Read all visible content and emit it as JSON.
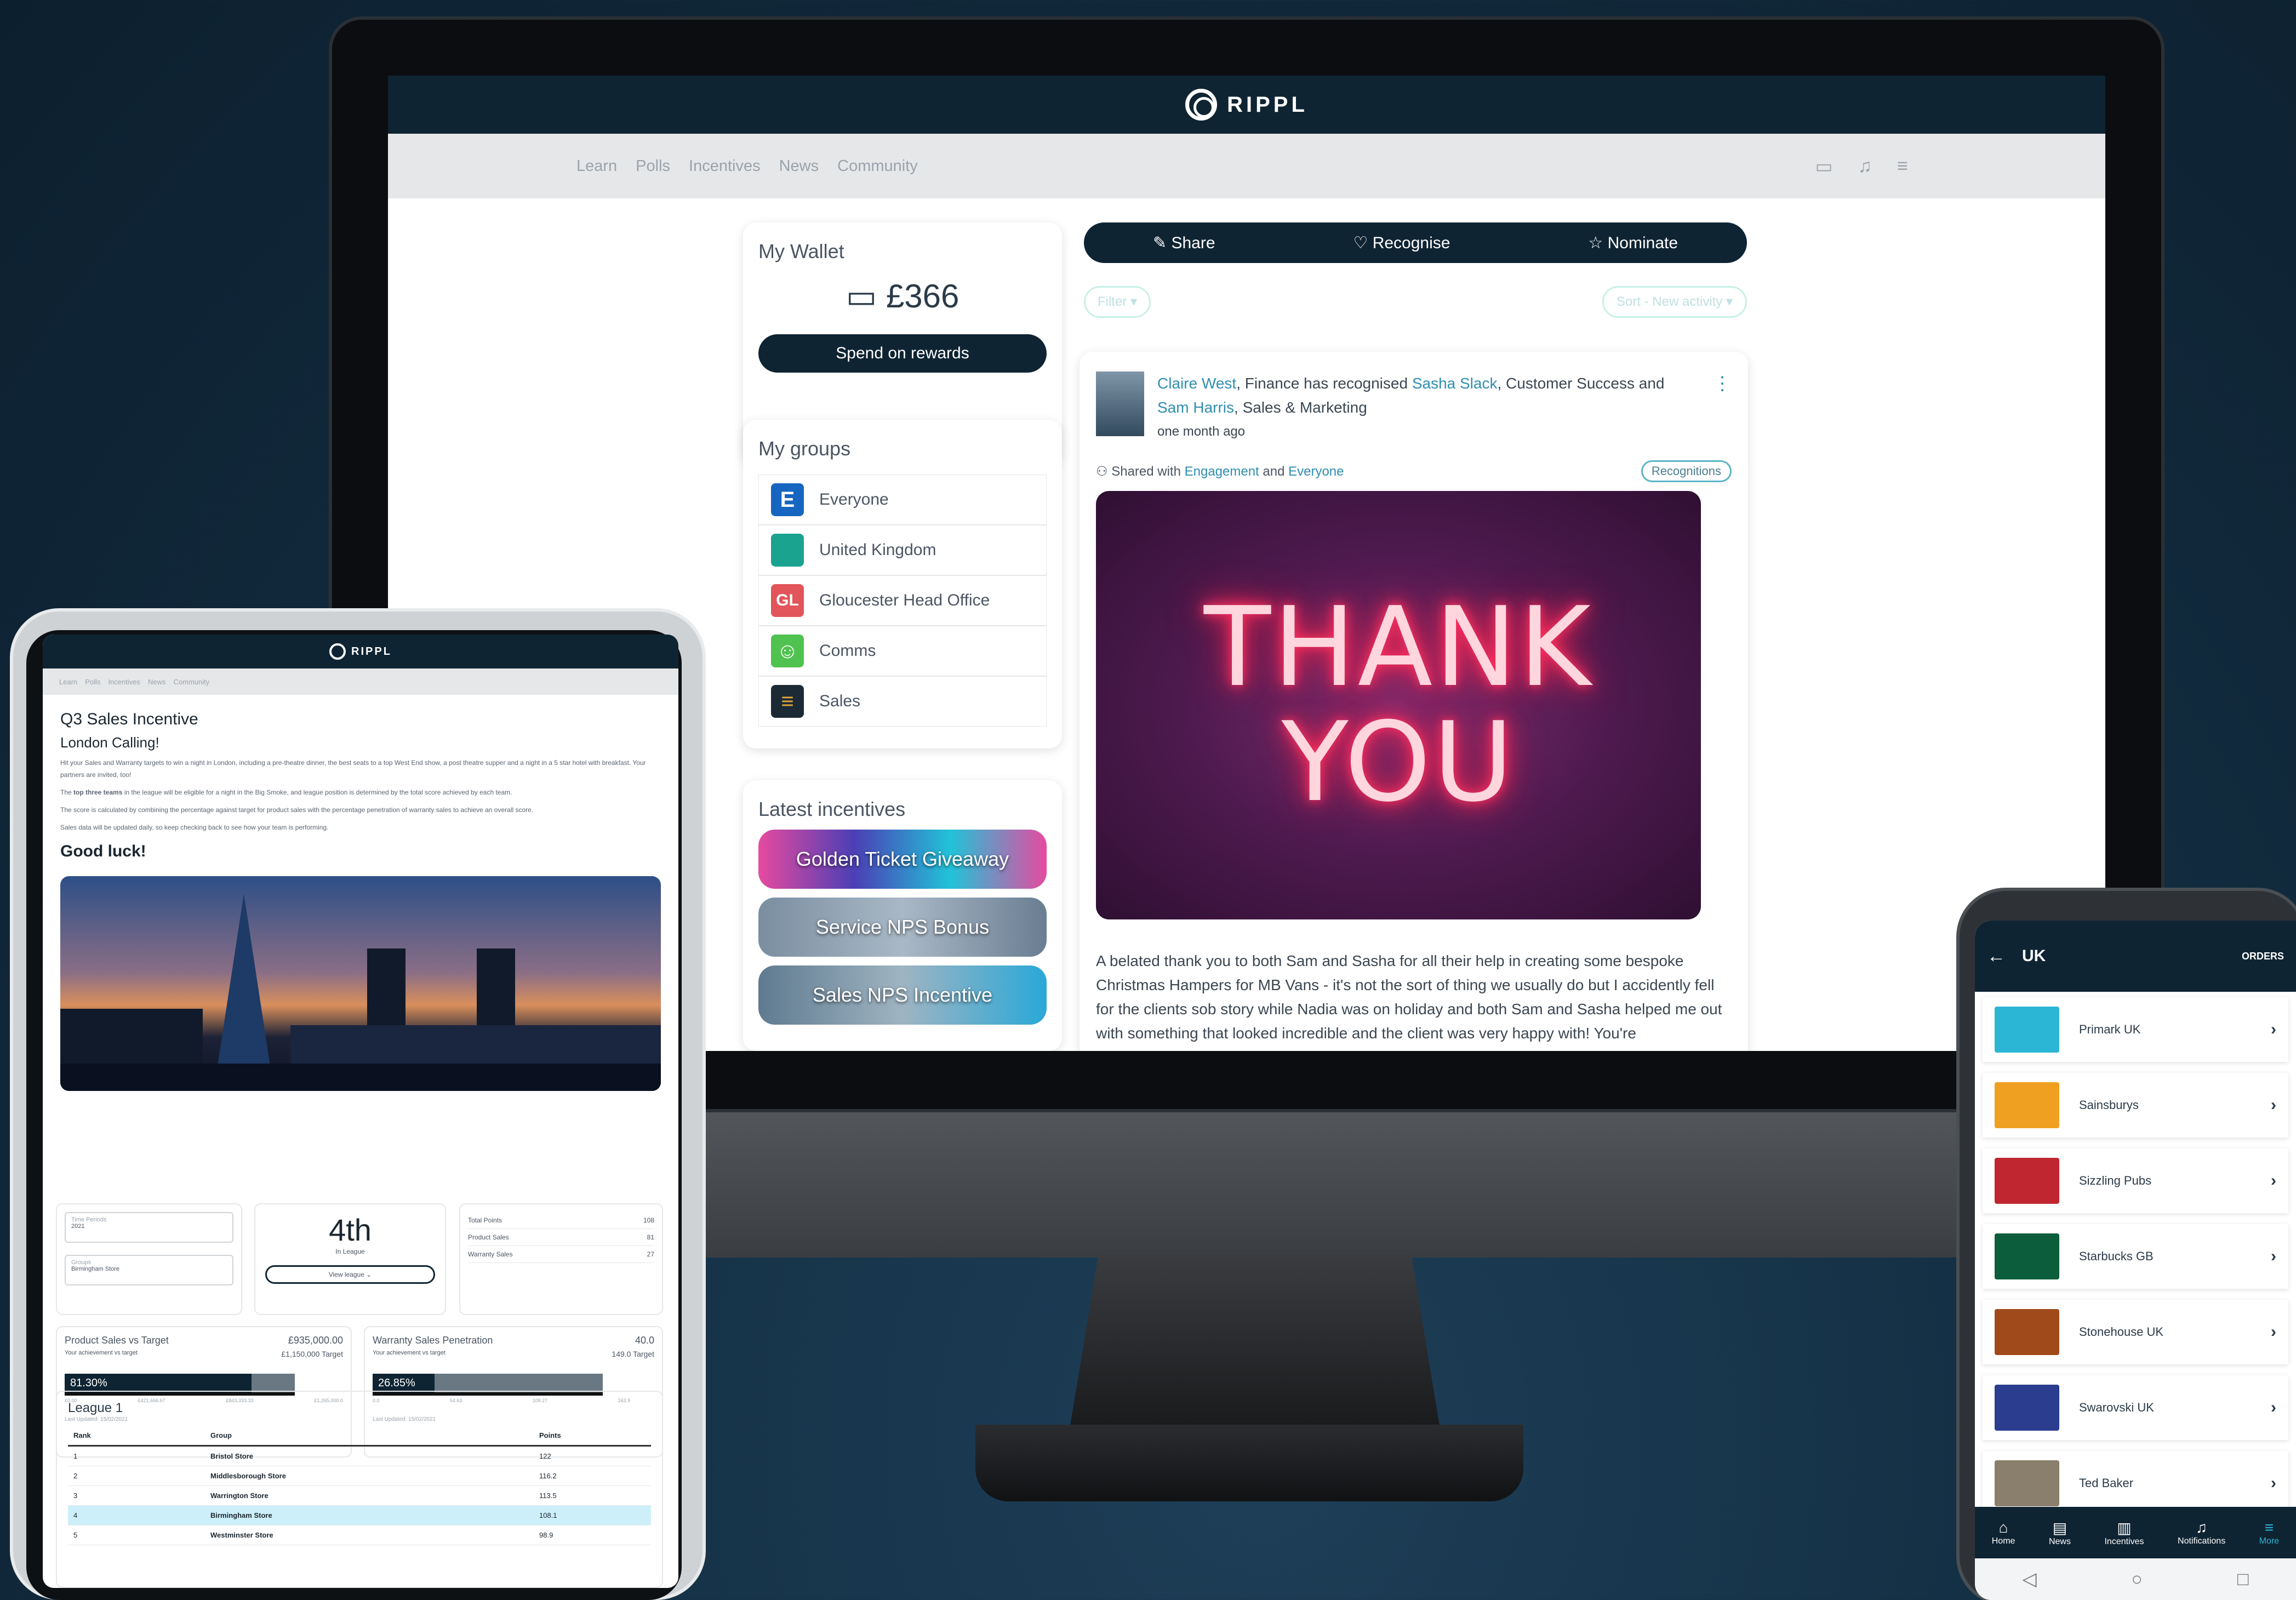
{
  "app": {
    "brand": "RIPPL"
  },
  "nav": {
    "items": [
      "Learn",
      "Polls",
      "Incentives",
      "News",
      "Community"
    ]
  },
  "wallet": {
    "title": "My Wallet",
    "amount": "£366",
    "button": "Spend on rewards"
  },
  "groups": {
    "title": "My groups",
    "items": [
      {
        "label": "Everyone",
        "badge": "E",
        "color": "#1665c0"
      },
      {
        "label": "United Kingdom",
        "badge": "",
        "color": "#1aa38f"
      },
      {
        "label": "Gloucester Head Office",
        "badge": "GL",
        "color": "#e2555a"
      },
      {
        "label": "Comms",
        "badge": "",
        "color": "#4fc24f"
      },
      {
        "label": "Sales",
        "badge": "",
        "color": "#1c2a36"
      }
    ]
  },
  "incentives": {
    "title": "Latest incentives",
    "items": [
      "Golden Ticket Giveaway",
      "Service NPS Bonus",
      "Sales NPS Incentive"
    ]
  },
  "actions": {
    "share": "Share",
    "recognise": "Recognise",
    "nominate": "Nominate"
  },
  "filters": {
    "filter": "Filter",
    "sort": "Sort - New activity"
  },
  "post": {
    "author": "Claire West",
    "t1": ", Finance has recognised ",
    "recipient1": "Sasha Slack",
    "t2": ", Customer Success and ",
    "recipient2": "Sam Harris",
    "t3": ", Sales & Marketing",
    "time": "one month ago",
    "shared_prefix": "Shared with",
    "shared_group1": "Engagement",
    "shared_and": "and",
    "shared_group2": "Everyone",
    "badge": "Recognitions",
    "neon_line1": "THANK",
    "neon_line2": "YOU",
    "body": "A belated thank you to both Sam and Sasha for all their help in creating some bespoke Christmas Hampers for MB Vans - it's not the sort of thing we usually do but I accidently fell for the clients sob story while Nadia was on holiday and both Sam and Sasha helped me out with something that looked incredible and the client was very happy with! You're"
  },
  "tablet": {
    "brand": "RIPPL",
    "nav": [
      "Learn",
      "Polls",
      "Incentives",
      "News",
      "Community"
    ],
    "title": "Q3 Sales Incentive",
    "subtitle": "London Calling!",
    "para1": "Hit your Sales and Warranty targets to win a night in London, including a pre-theatre dinner, the best seats to a top West End show, a post theatre supper and a night in a 5 star hotel with breakfast. Your partners are invited, too!",
    "para2_bold": "top three teams",
    "para2_pre": "The ",
    "para2_post": " in the league will be eligible for a night in the Big Smoke, and league position is determined by the total score achieved by each team.",
    "para3": "The score is calculated by combining the percentage against target for product sales with the percentage penetration of warranty sales to achieve an overall score.",
    "para4": "Sales data will be updated daily, so keep checking back to see how your team is performing.",
    "luck": "Good luck!",
    "time_period_label": "Time Periods",
    "time_period_value": "2021",
    "groups_label": "Groups",
    "groups_value": "Birmingham Store",
    "position": "4th",
    "position_label": "In League",
    "view_league": "View league",
    "totals": [
      {
        "label": "Total Points",
        "value": "108"
      },
      {
        "label": "Product Sales",
        "value": "81"
      },
      {
        "label": "Warranty Sales",
        "value": "27"
      }
    ],
    "product_card": {
      "title": "Product Sales vs Target",
      "sub": "Your achievement vs target",
      "value": "£935,000.00",
      "target": "£1,150,000 Target",
      "percent_label": "81.30%",
      "percent": 81.3,
      "ticks": [
        "£0.00",
        "£421,666.67",
        "£843,333.33",
        "£1,265,000.0"
      ],
      "updated": "Last Updated: 15/02/2021"
    },
    "warranty_card": {
      "title": "Warranty Sales Penetration",
      "sub": "Your achievement vs target",
      "value": "40.0",
      "target": "149.0 Target",
      "percent_label": "26.85%",
      "percent": 26.85,
      "ticks": [
        "0.0",
        "54.63",
        "109.27",
        "163.9"
      ],
      "updated": "Last Updated: 15/02/2021"
    },
    "league": {
      "title": "League 1",
      "headers": [
        "Rank",
        "Group",
        "Points"
      ],
      "rows": [
        [
          "1",
          "Bristol Store",
          "122"
        ],
        [
          "2",
          "Middlesborough Store",
          "116.2"
        ],
        [
          "3",
          "Warrington Store",
          "113.5"
        ],
        [
          "4",
          "Birmingham Store",
          "108.1"
        ],
        [
          "5",
          "Westminster Store",
          "98.9"
        ]
      ]
    }
  },
  "phone": {
    "title": "UK",
    "orders": "ORDERS",
    "items": [
      {
        "label": "Primark UK",
        "color": "#2bb6d6"
      },
      {
        "label": "Sainsburys",
        "color": "#f0a020"
      },
      {
        "label": "Sizzling Pubs",
        "color": "#c0262f"
      },
      {
        "label": "Starbucks GB",
        "color": "#0b5d3b"
      },
      {
        "label": "Stonehouse UK",
        "color": "#a04a1c"
      },
      {
        "label": "Swarovski UK",
        "color": "#2a3d8f"
      },
      {
        "label": "Ted Baker",
        "color": "#8a7e6c"
      }
    ],
    "nav": [
      "Home",
      "News",
      "Incentives",
      "Notifications",
      "More"
    ]
  }
}
